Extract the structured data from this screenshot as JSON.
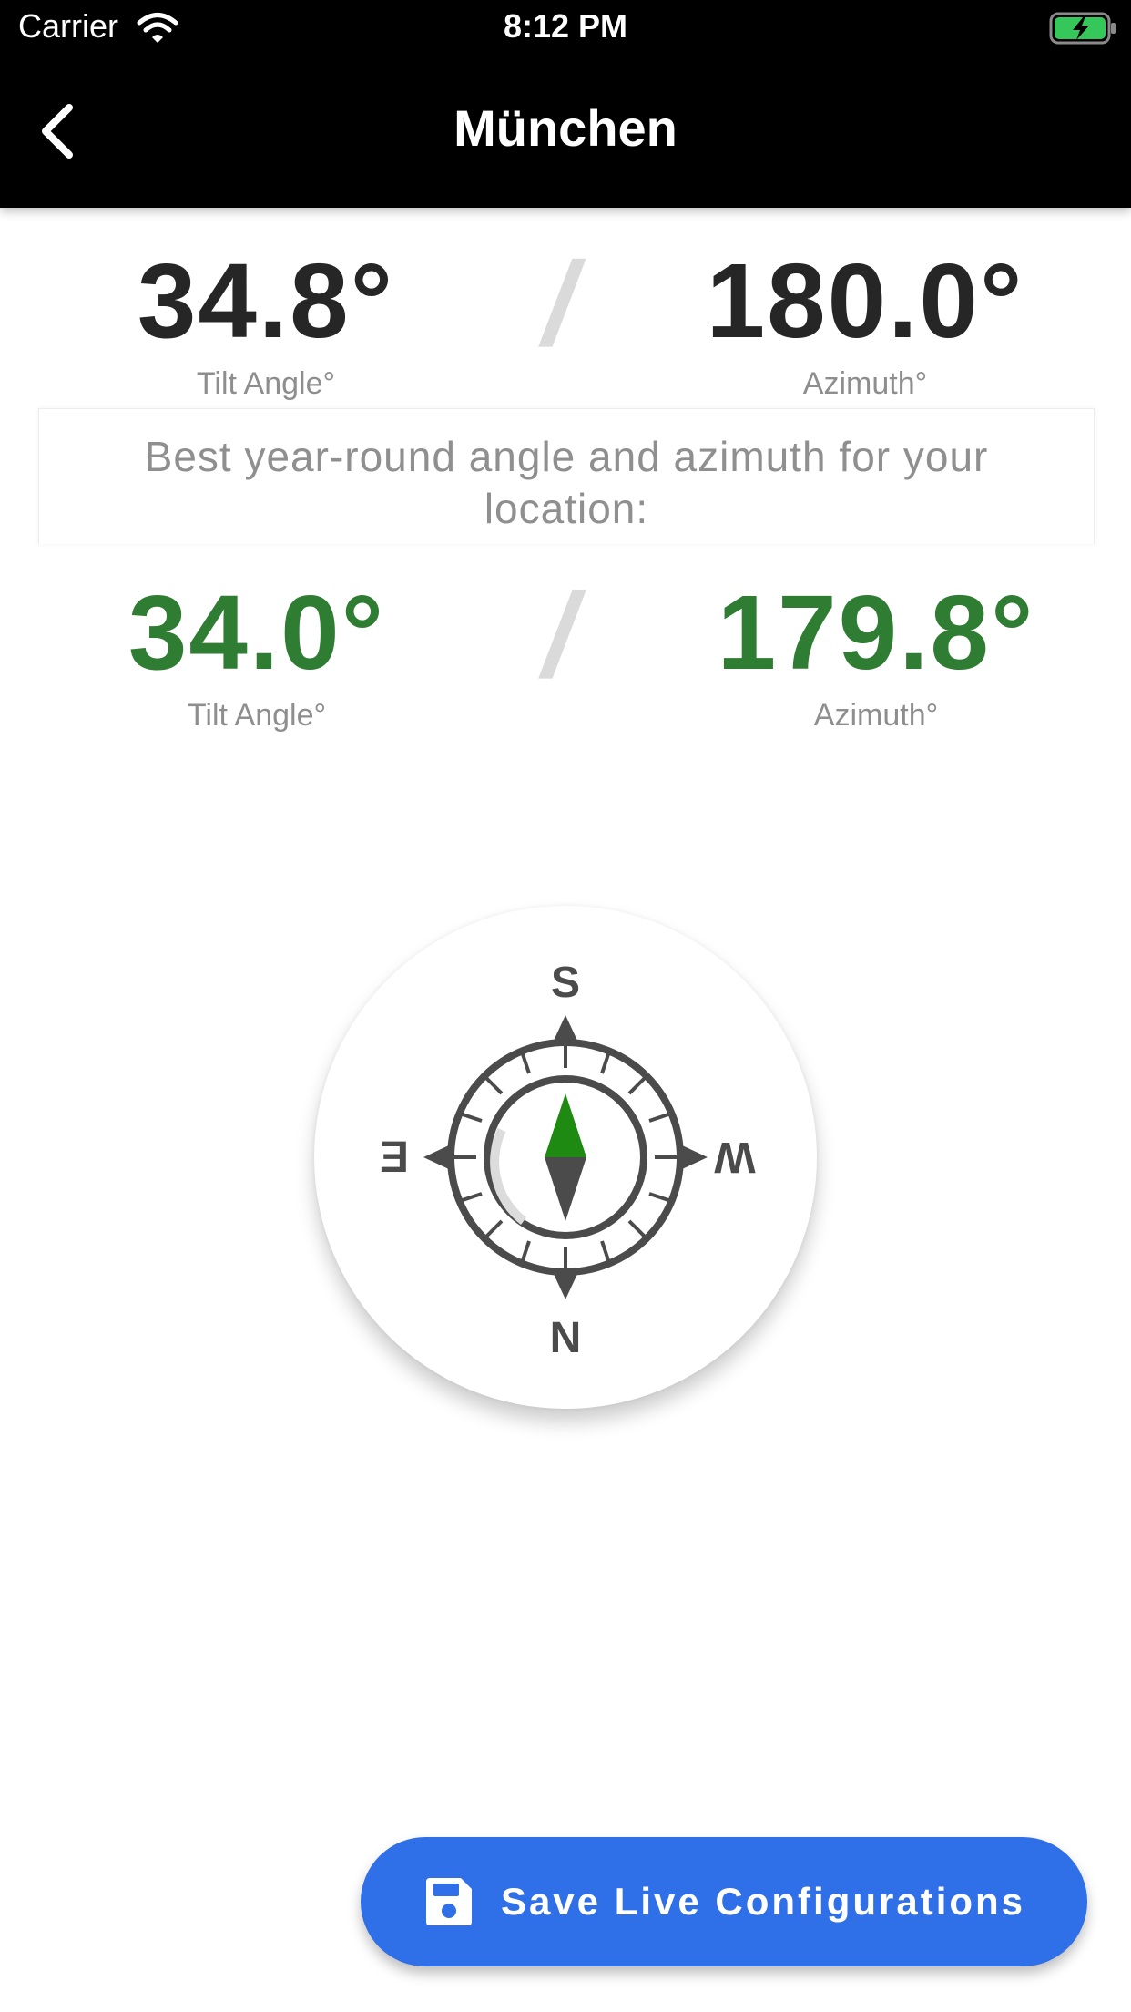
{
  "status_bar": {
    "carrier": "Carrier",
    "time": "8:12 PM",
    "wifi_icon": "wifi-icon",
    "battery_icon": "battery-charging-icon"
  },
  "nav": {
    "title": "München",
    "back_icon": "chevron-left-icon"
  },
  "live_reading": {
    "tilt_value": "34.8°",
    "tilt_label": "Tilt Angle°",
    "azimuth_value": "180.0°",
    "azimuth_label": "Azimuth°",
    "separator": "/"
  },
  "info_card": {
    "text": "Best year-round angle and azimuth for your location:"
  },
  "best_reading": {
    "tilt_value": "34.0°",
    "tilt_label": "Tilt Angle°",
    "azimuth_value": "179.8°",
    "azimuth_label": "Azimuth°",
    "separator": "/"
  },
  "compass": {
    "top": "S",
    "bottom": "N",
    "left": "E",
    "right": "W",
    "icon": "compass-icon"
  },
  "save_button": {
    "label": "Save Live Configurations",
    "icon": "floppy-disk-icon"
  },
  "colors": {
    "header_bg": "#000000",
    "best_value": "#2e7d32",
    "button_bg": "#2f6fe8",
    "needle_green": "#1f8a12"
  }
}
